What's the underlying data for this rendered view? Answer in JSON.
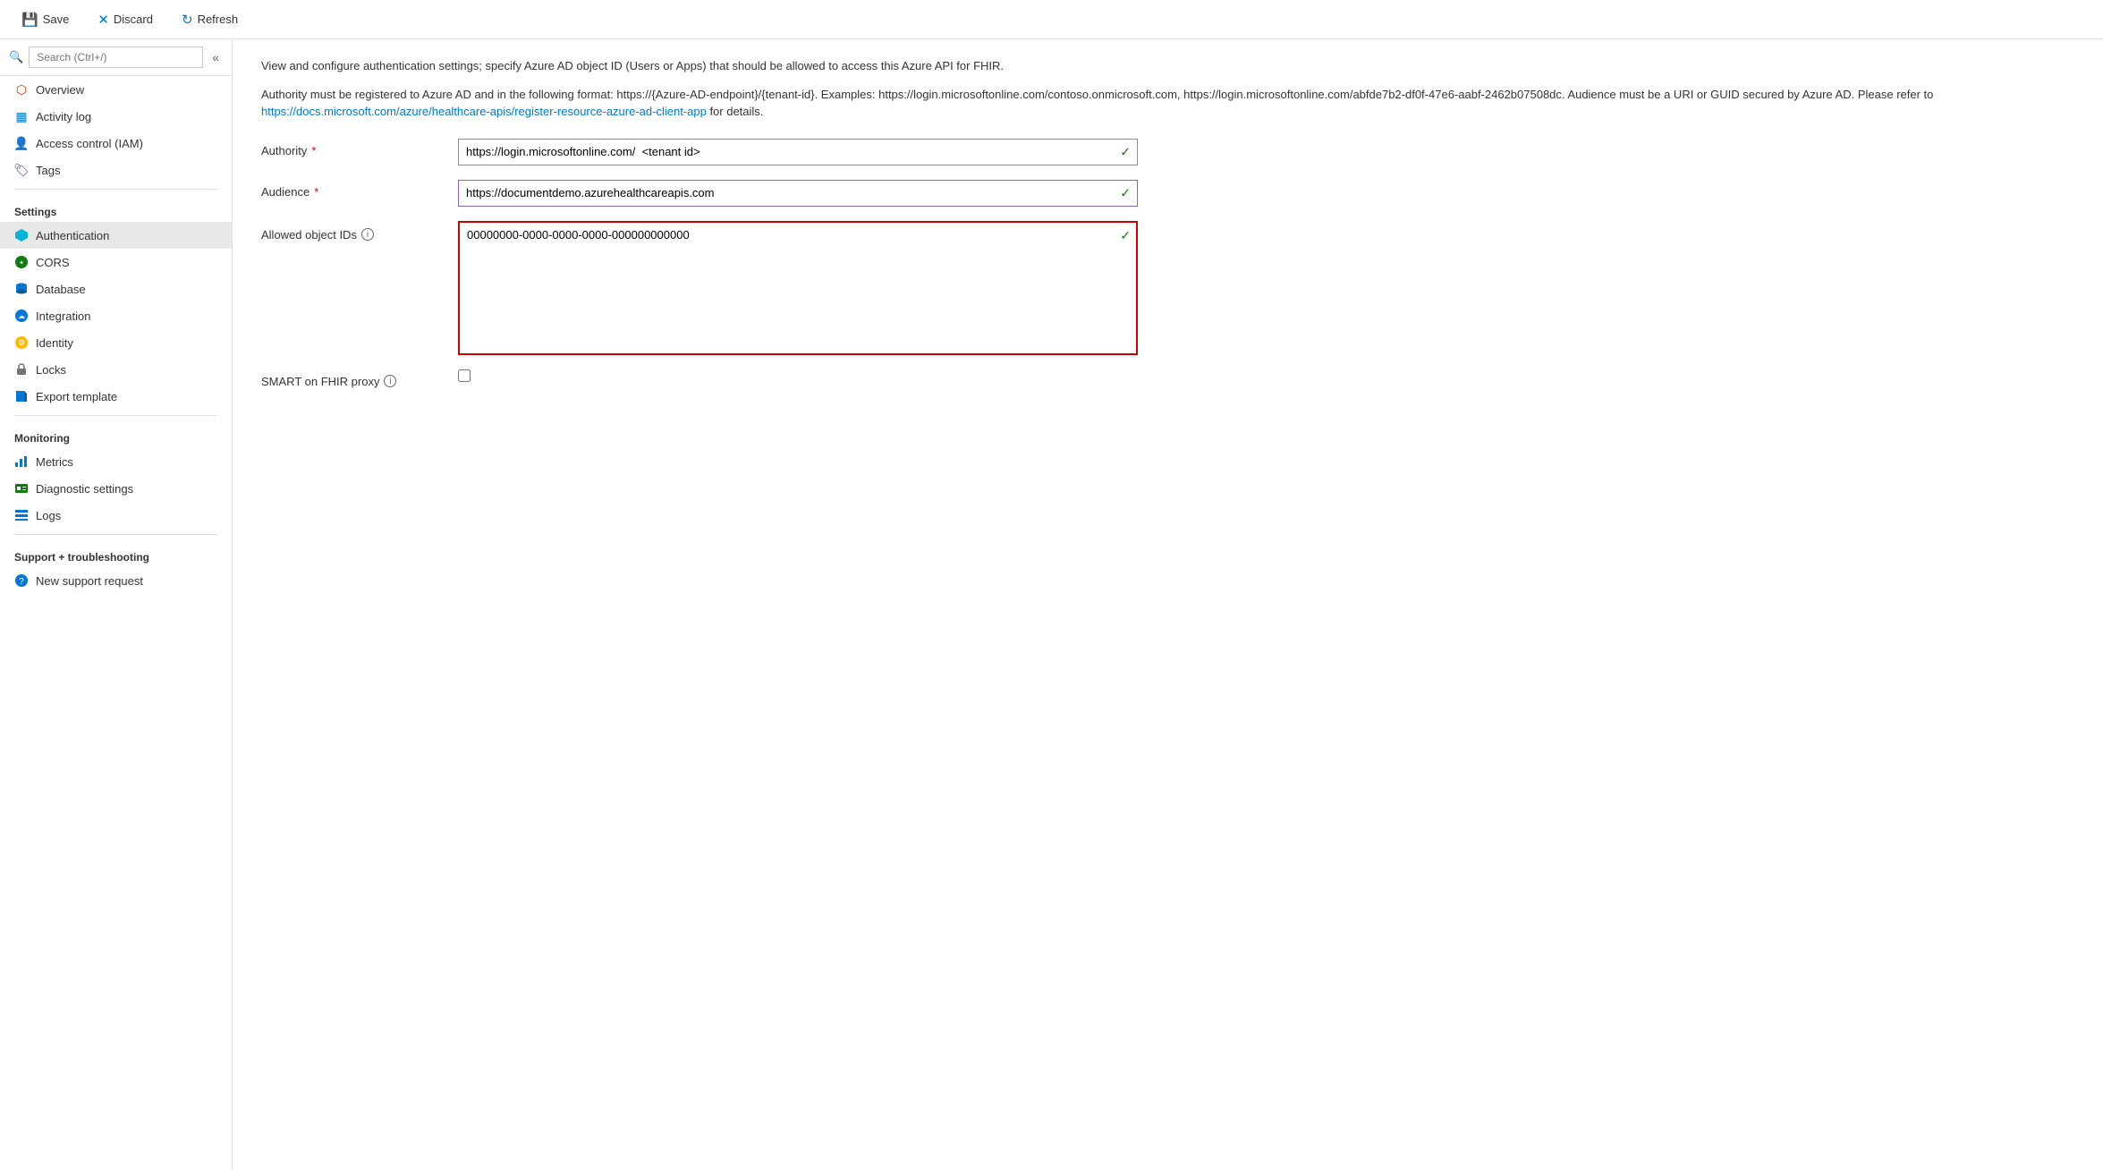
{
  "toolbar": {
    "save_label": "Save",
    "discard_label": "Discard",
    "refresh_label": "Refresh"
  },
  "sidebar": {
    "search_placeholder": "Search (Ctrl+/)",
    "items_top": [
      {
        "id": "overview",
        "label": "Overview",
        "icon": "🔶"
      },
      {
        "id": "activity-log",
        "label": "Activity log",
        "icon": "🔷"
      },
      {
        "id": "access-control",
        "label": "Access control (IAM)",
        "icon": "👤"
      },
      {
        "id": "tags",
        "label": "Tags",
        "icon": "🏷️"
      }
    ],
    "settings_label": "Settings",
    "settings_items": [
      {
        "id": "authentication",
        "label": "Authentication",
        "icon": "diamond",
        "active": true
      },
      {
        "id": "cors",
        "label": "CORS",
        "icon": "cors"
      },
      {
        "id": "database",
        "label": "Database",
        "icon": "database"
      },
      {
        "id": "integration",
        "label": "Integration",
        "icon": "integration"
      },
      {
        "id": "identity",
        "label": "Identity",
        "icon": "identity"
      },
      {
        "id": "locks",
        "label": "Locks",
        "icon": "lock"
      },
      {
        "id": "export-template",
        "label": "Export template",
        "icon": "export"
      }
    ],
    "monitoring_label": "Monitoring",
    "monitoring_items": [
      {
        "id": "metrics",
        "label": "Metrics",
        "icon": "metrics"
      },
      {
        "id": "diagnostic-settings",
        "label": "Diagnostic settings",
        "icon": "diagnostic"
      },
      {
        "id": "logs",
        "label": "Logs",
        "icon": "logs"
      }
    ],
    "support_label": "Support + troubleshooting",
    "support_items": [
      {
        "id": "new-support-request",
        "label": "New support request",
        "icon": "support"
      }
    ]
  },
  "content": {
    "description1": "View and configure authentication settings; specify Azure AD object ID (Users or Apps) that should be allowed to access this Azure API for FHIR.",
    "description2": "Authority must be registered to Azure AD and in the following format: https://{Azure-AD-endpoint}/{tenant-id}. Examples: https://login.microsoftonline.com/contoso.onmicrosoft.com, https://login.microsoftonline.com/abfde7b2-df0f-47e6-aabf-2462b07508dc. Audience must be a URI or GUID secured by Azure AD. Please refer to ",
    "description_link_text": "https://docs.microsoft.com/azure/healthcare-apis/register-resource-azure-ad-client-app",
    "description_link_url": "#",
    "description3": " for details.",
    "fields": {
      "authority_label": "Authority",
      "authority_value": "https://login.microsoftonline.com/  <tenant id>",
      "audience_label": "Audience",
      "audience_value": "https://documentdemo.azurehealthcareapis.com",
      "allowed_ids_label": "Allowed object IDs",
      "allowed_ids_value": "00000000-0000-0000-0000-000000000000",
      "smart_label": "SMART on FHIR proxy"
    }
  }
}
